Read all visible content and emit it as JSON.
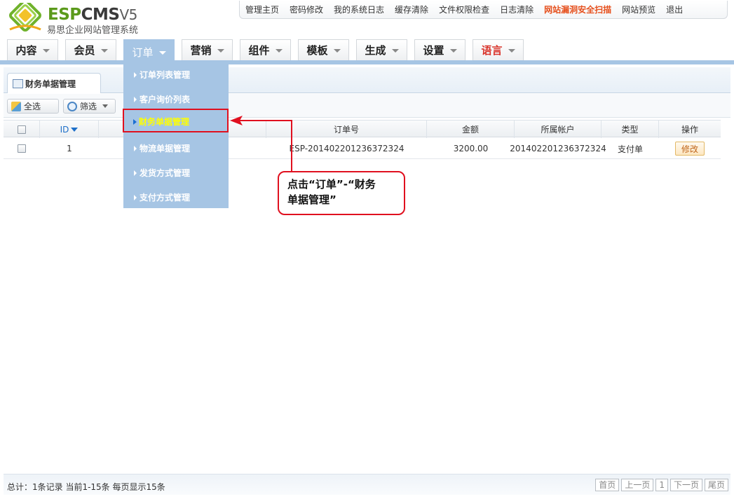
{
  "app": {
    "brand": {
      "esp": "ESP",
      "cms": "CMS",
      "version": "V5",
      "subtitle": "易思企业网站管理系统"
    }
  },
  "topbar": {
    "links": [
      "管理主页",
      "密码修改",
      "我的系统日志",
      "缓存清除",
      "文件权限检查",
      "日志清除",
      "网站漏洞安全扫描",
      "网站预览",
      "退出"
    ]
  },
  "mainnav": {
    "tabs": [
      "内容",
      "会员",
      "订单",
      "营销",
      "组件",
      "模板",
      "生成",
      "设置",
      "语言"
    ],
    "active": "订单"
  },
  "panel": {
    "tab_label": "财务单据管理"
  },
  "toolbar": {
    "select_all": "全选",
    "filter": "筛选"
  },
  "table": {
    "headers": [
      "ID",
      "订单号",
      "金额",
      "所属帐户",
      "类型",
      "操作"
    ],
    "rows": [
      {
        "id": "1",
        "order_no": "ESP-201402201236372324",
        "amount": "3200.00",
        "account": "201402201236372324",
        "type": "支付单",
        "action": "修改"
      }
    ]
  },
  "footer": {
    "summary": "总计：1条记录 当前1-15条 每页显示15条",
    "pager": [
      "首页",
      "上一页",
      "1",
      "下一页",
      "尾页"
    ]
  },
  "dropdown": {
    "items": [
      "订单列表管理",
      "客户询价列表",
      "财务单据管理",
      "物流单据管理",
      "发货方式管理",
      "支付方式管理"
    ],
    "highlighted": "财务单据管理"
  },
  "annotation": {
    "line1": "点击“订单”-“财务",
    "line2": "单据管理”"
  },
  "colors": {
    "nav_active": "#a6c5e4",
    "highlight_red": "#e0101f",
    "warn_link": "#e6501d"
  }
}
